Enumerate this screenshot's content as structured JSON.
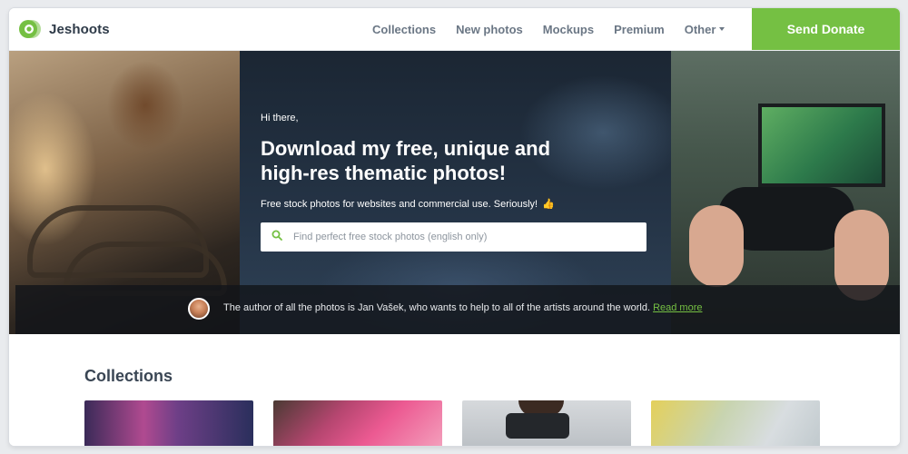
{
  "brand": {
    "name": "Jeshoots",
    "accent": "#75c043"
  },
  "nav": {
    "items": [
      "Collections",
      "New photos",
      "Mockups",
      "Premium",
      "Other"
    ],
    "donate_label": "Send Donate"
  },
  "hero": {
    "greeting": "Hi there,",
    "headline": "Download my free, unique and high-res thematic photos!",
    "subtitle": "Free stock photos for websites and commercial use. Seriously!",
    "subtitle_emoji": "👍",
    "search_placeholder": "Find perfect free stock photos (english only)"
  },
  "author_bar": {
    "text": "The author of all the photos is Jan Vašek, who wants to help to all of the artists around the world. ",
    "link": "Read more"
  },
  "collections": {
    "title": "Collections",
    "cards": [
      "casino-slots",
      "shopping-bags",
      "vr-headset",
      "easter-eggs"
    ]
  },
  "icons": [
    "logo-mark-icon",
    "chevron-down-icon",
    "search-icon",
    "thumbs-up-icon"
  ]
}
